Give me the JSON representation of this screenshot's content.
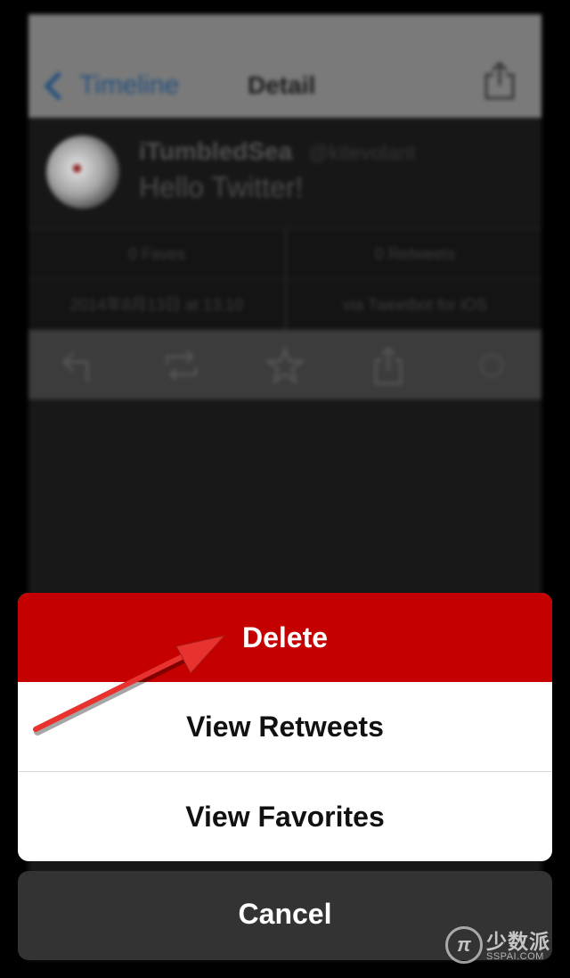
{
  "background": {
    "nav": {
      "back_label": "Timeline",
      "title": "Detail"
    },
    "tweet": {
      "name": "iTumbledSea",
      "handle": "@kitevolant",
      "text": "Hello Twitter!"
    },
    "stats": {
      "faves": "0 Faves",
      "retweets": "0 Retweets",
      "date": "2014年8月13日 at 13:10",
      "via": "via Tweetbot for iOS"
    },
    "actions": [
      "reply-icon",
      "retweet-icon",
      "star-icon",
      "share-icon",
      "more-icon"
    ]
  },
  "action_sheet": {
    "delete_label": "Delete",
    "view_retweets_label": "View Retweets",
    "view_favorites_label": "View Favorites",
    "cancel_label": "Cancel"
  },
  "watermark": {
    "cn": "少数派",
    "en": "SSPAI.COM"
  },
  "colors": {
    "delete": "#c40000",
    "arrow": "#e8322f",
    "cancel_bg": "#333333"
  }
}
